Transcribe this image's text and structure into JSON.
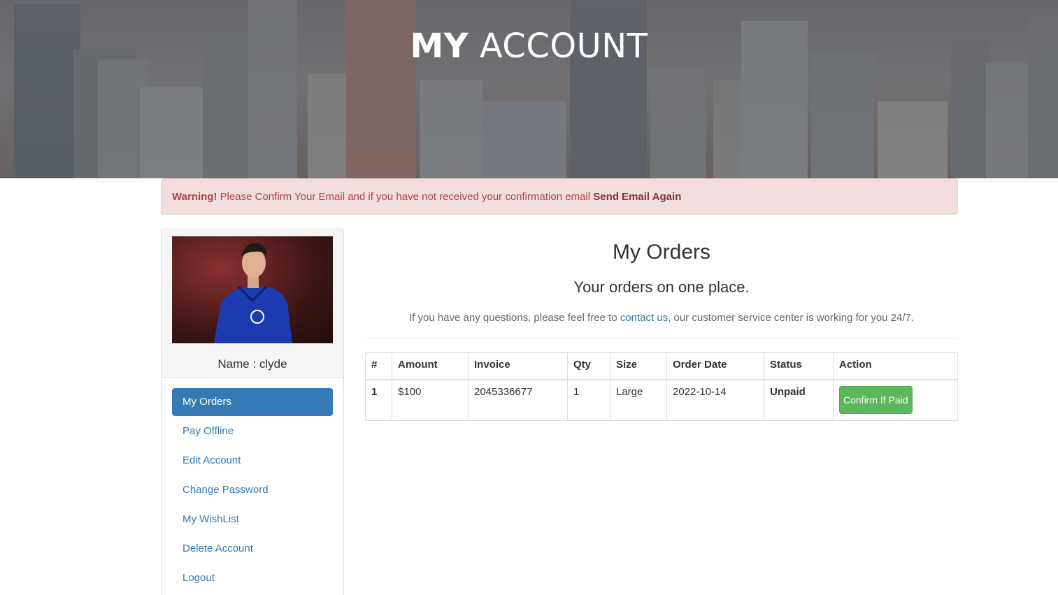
{
  "hero": {
    "title_bold": "MY",
    "title_rest": "ACCOUNT"
  },
  "alert": {
    "label": "Warning!",
    "message": " Please Confirm Your Email and if you have not received your confirmation email ",
    "link": "Send Email Again"
  },
  "profile": {
    "name": "Name : clyde"
  },
  "sidebar": {
    "items": [
      {
        "label": "My Orders"
      },
      {
        "label": "Pay Offline"
      },
      {
        "label": "Edit Account"
      },
      {
        "label": "Change Password"
      },
      {
        "label": "My WishList"
      },
      {
        "label": "Delete Account"
      },
      {
        "label": "Logout"
      }
    ]
  },
  "main": {
    "title": "My Orders",
    "subtitle": "Your orders on one place.",
    "note_prefix": "If you have any questions, please feel free to ",
    "note_link": "contact us",
    "note_suffix": ", our customer service center is working for you 24/7."
  },
  "table": {
    "headers": [
      "#",
      "Amount",
      "Invoice",
      "Qty",
      "Size",
      "Order Date",
      "Status",
      "Action"
    ],
    "rows": [
      {
        "num": "1",
        "amount": "$100",
        "invoice": "2045336677",
        "qty": "1",
        "size": "Large",
        "date": "2022-10-14",
        "status": "Unpaid",
        "action": "Confirm If Paid"
      }
    ]
  },
  "colors": {
    "primary": "#337ab7",
    "alert_bg": "#f2dede",
    "alert_text": "#a94442",
    "success": "#5cb85c",
    "status_unpaid": "#e00000"
  }
}
